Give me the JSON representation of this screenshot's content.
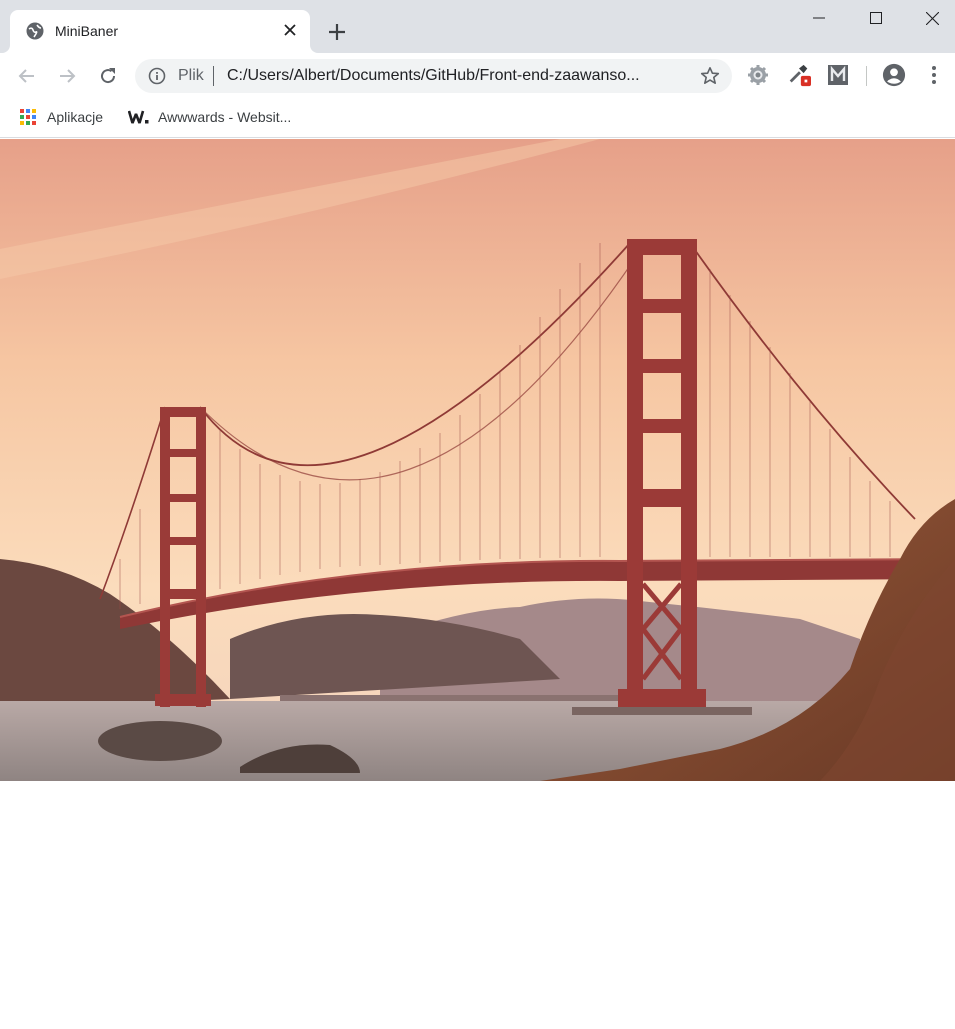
{
  "tab": {
    "title": "MiniBaner",
    "favicon": "globe-icon",
    "close_icon": "close-icon"
  },
  "window_controls": [
    "minimize-icon",
    "maximize-icon",
    "close-icon"
  ],
  "toolbar": {
    "back_icon": "arrow-back-icon",
    "forward_icon": "arrow-forward-icon",
    "reload_icon": "reload-icon",
    "omnibox": {
      "scheme_label": "Plik",
      "url": "C:/Users/Albert/Documents/GitHub/Front-end-zaawanso...",
      "info_icon": "info-icon",
      "star_icon": "star-icon"
    },
    "extensions": [
      "gear-extension-icon",
      "color-picker-extension-icon",
      "m-extension-icon"
    ],
    "profile_icon": "account-icon",
    "menu_icon": "kebab-menu-icon"
  },
  "bookmarks": [
    {
      "label": "Aplikacje",
      "icon": "apps-grid-icon"
    },
    {
      "label": "Awwwards - Websit...",
      "icon": "awwwards-logo-icon"
    }
  ],
  "page": {
    "banner_image": "golden-gate-bridge-photo",
    "colors": {
      "sky_top": "#e9a58c",
      "sky_bottom": "#fbd8b5",
      "bridge": "#9a3b38",
      "water": "#a79b98",
      "rocks": "#7a4a33"
    }
  }
}
